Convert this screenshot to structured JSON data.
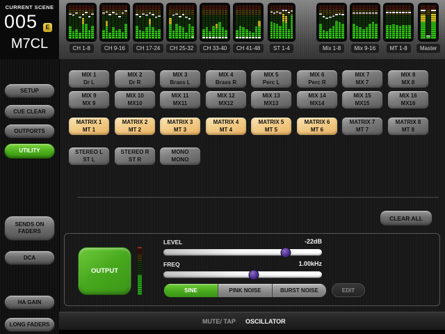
{
  "scene": {
    "label": "CURRENT SCENE",
    "number": "005",
    "edit_badge": "E",
    "console_name": "M7CL"
  },
  "colors": {
    "accent_green": "#47a81d",
    "selected_orange": "#eab362",
    "meter_green": "#2fc412",
    "meter_yellow": "#dcc71c",
    "slider_handle_purple": "#503093",
    "badge_gold": "#c9a51f"
  },
  "meter_bridge": {
    "groups": [
      {
        "label": "CH 1-8",
        "bars": [
          38,
          22,
          30,
          18,
          62,
          45,
          28,
          40
        ],
        "tips": [
          false,
          false,
          false,
          false,
          true,
          false,
          false,
          false
        ],
        "marks": [
          72,
          68,
          75,
          62,
          70,
          78,
          65,
          72
        ]
      },
      {
        "label": "CH 9-16",
        "bars": [
          28,
          55,
          18,
          35,
          25,
          30,
          20,
          45
        ],
        "tips": [
          false,
          true,
          false,
          false,
          false,
          false,
          false,
          false
        ],
        "marks": [
          75,
          80,
          70,
          78,
          72,
          65,
          74,
          82
        ]
      },
      {
        "label": "CH 17-24",
        "bars": [
          40,
          28,
          22,
          35,
          60,
          35,
          25,
          30
        ],
        "tips": [
          false,
          false,
          false,
          false,
          true,
          false,
          false,
          false
        ],
        "marks": [
          70,
          65,
          72,
          68,
          75,
          70,
          62,
          66
        ]
      },
      {
        "label": "CH 25-32",
        "bars": [
          62,
          25,
          45,
          40,
          35,
          18,
          45,
          38
        ],
        "tips": [
          true,
          false,
          false,
          false,
          false,
          false,
          false,
          false
        ],
        "marks": [
          null,
          68,
          72,
          65,
          70,
          62,
          58,
          4
        ]
      },
      {
        "label": "CH 33-40",
        "bars": [
          30,
          35,
          22,
          40,
          45,
          50,
          35,
          28
        ],
        "tips": [
          false,
          false,
          false,
          false,
          true,
          false,
          false,
          false
        ],
        "marks": [
          3,
          3,
          3,
          3,
          3,
          3,
          3,
          3
        ]
      },
      {
        "label": "CH 41-48",
        "bars": [
          28,
          40,
          35,
          30,
          22,
          18,
          38,
          55
        ],
        "tips": [
          false,
          false,
          false,
          false,
          false,
          false,
          false,
          true
        ],
        "marks": [
          3,
          3,
          3,
          3,
          3,
          3,
          3,
          3
        ]
      },
      {
        "label": "ST 1-4",
        "bars": [
          52,
          48,
          45,
          40,
          75,
          68,
          30,
          72
        ],
        "tips": [
          false,
          false,
          false,
          false,
          true,
          true,
          false,
          false
        ],
        "marks": [
          80,
          76,
          80,
          76,
          84,
          84,
          78,
          82
        ]
      },
      {
        "label": "Mix 1-8",
        "bars": [
          45,
          28,
          22,
          32,
          40,
          55,
          50,
          45
        ],
        "tips": [
          false,
          false,
          false,
          false,
          false,
          false,
          false,
          false
        ],
        "marks": [
          72,
          65,
          60,
          62,
          66,
          70,
          72,
          70
        ]
      },
      {
        "label": "Mix 9-16",
        "bars": [
          45,
          40,
          35,
          30,
          35,
          45,
          52,
          45
        ],
        "tips": [
          false,
          false,
          false,
          false,
          false,
          false,
          false,
          false
        ],
        "marks": [
          74,
          74,
          74,
          74,
          74,
          74,
          74,
          74
        ]
      },
      {
        "label": "MT 1-8",
        "bars": [
          42,
          42,
          44,
          42,
          40,
          42,
          42,
          42
        ],
        "tips": [
          false,
          false,
          false,
          false,
          false,
          false,
          false,
          false
        ],
        "marks": [
          78,
          78,
          78,
          78,
          78,
          78,
          78,
          78
        ]
      },
      {
        "label": "Master",
        "bars": [
          72,
          8,
          76
        ],
        "tips": [
          true,
          false,
          true
        ],
        "marks": [
          84,
          6,
          84
        ]
      }
    ]
  },
  "sidebar": {
    "buttons": [
      {
        "label": "SETUP",
        "active": false,
        "tall": false
      },
      {
        "label": "CUE CLEAR",
        "active": false,
        "tall": false
      },
      {
        "label": "OUTPORTS",
        "active": false,
        "tall": false
      },
      {
        "label": "UTILITY",
        "active": true,
        "tall": false
      },
      {
        "label": "SENDS ON FADERS",
        "active": false,
        "tall": true
      },
      {
        "label": "DCA",
        "active": false,
        "tall": false
      },
      {
        "label": "HA GAIN",
        "active": false,
        "tall": false
      },
      {
        "label": "LONG FADERS",
        "active": false,
        "tall": false
      }
    ]
  },
  "channel_grid": {
    "rows": [
      [
        {
          "line1": "MIX 1",
          "line2": "Dr L",
          "selected": false
        },
        {
          "line1": "MIX 2",
          "line2": "Dr R",
          "selected": false
        },
        {
          "line1": "MIX 3",
          "line2": "Brass L",
          "selected": false
        },
        {
          "line1": "MIX 4",
          "line2": "Brass R",
          "selected": false
        },
        {
          "line1": "MIX 5",
          "line2": "Perc L",
          "selected": false
        },
        {
          "line1": "MIX 6",
          "line2": "Perc R",
          "selected": false
        },
        {
          "line1": "MIX 7",
          "line2": "MX 7",
          "selected": false
        },
        {
          "line1": "MIX 8",
          "line2": "MX 8",
          "selected": false
        }
      ],
      [
        {
          "line1": "MIX 9",
          "line2": "MX 9",
          "selected": false
        },
        {
          "line1": "MIX 10",
          "line2": "MX10",
          "selected": false
        },
        {
          "line1": "MIX 11",
          "line2": "MX11",
          "selected": false
        },
        {
          "line1": "MIX 12",
          "line2": "MX12",
          "selected": false
        },
        {
          "line1": "MIX 13",
          "line2": "MX13",
          "selected": false
        },
        {
          "line1": "MIX 14",
          "line2": "MX14",
          "selected": false
        },
        {
          "line1": "MIX 15",
          "line2": "MX15",
          "selected": false
        },
        {
          "line1": "MIX 16",
          "line2": "MX16",
          "selected": false
        }
      ],
      [
        {
          "line1": "MATRIX 1",
          "line2": "MT 1",
          "selected": true
        },
        {
          "line1": "MATRIX 2",
          "line2": "MT 2",
          "selected": true
        },
        {
          "line1": "MATRIX 3",
          "line2": "MT 3",
          "selected": true
        },
        {
          "line1": "MATRIX 4",
          "line2": "MT 4",
          "selected": true
        },
        {
          "line1": "MATRIX 5",
          "line2": "MT 5",
          "selected": true
        },
        {
          "line1": "MATRIX 6",
          "line2": "MT 6",
          "selected": true
        },
        {
          "line1": "MATRIX 7",
          "line2": "MT 7",
          "selected": false
        },
        {
          "line1": "MATRIX 8",
          "line2": "MT 8",
          "selected": false
        }
      ],
      [
        {
          "line1": "STEREO L",
          "line2": "ST L",
          "selected": false
        },
        {
          "line1": "STEREO R",
          "line2": "ST R",
          "selected": false
        },
        {
          "line1": "MONO",
          "line2": "MONO",
          "selected": false
        }
      ]
    ]
  },
  "clear_all_label": "CLEAR ALL",
  "oscillator": {
    "output_label": "OUTPUT",
    "level": {
      "label": "LEVEL",
      "value": "-22dB",
      "pos": 77
    },
    "freq": {
      "label": "FREQ",
      "value": "1.00kHz",
      "pos": 57
    },
    "modes": [
      {
        "label": "SINE",
        "selected": true
      },
      {
        "label": "PINK NOISE",
        "selected": false
      },
      {
        "label": "BURST NOISE",
        "selected": false
      }
    ],
    "edit_label": "EDIT"
  },
  "bottom_bar": {
    "tabs": [
      {
        "label": "MUTE/ TAP",
        "selected": false
      },
      {
        "label": "OSCILLATOR",
        "selected": true
      }
    ]
  }
}
